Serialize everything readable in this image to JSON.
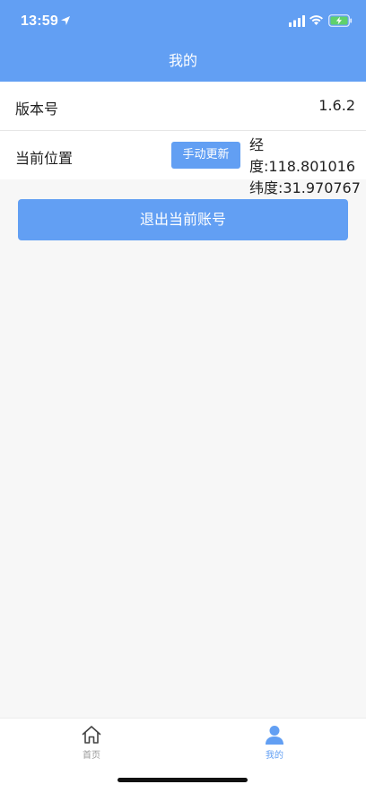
{
  "status": {
    "time": "13:59"
  },
  "header": {
    "title": "我的"
  },
  "settings": {
    "version_label": "版本号",
    "version_value": "1.6.2",
    "location_label": "当前位置",
    "update_button": "手动更新",
    "longitude": "经度:118.801016",
    "latitude": "纬度:31.970767"
  },
  "actions": {
    "logout": "退出当前账号"
  },
  "tabbar": {
    "home": "首页",
    "mine": "我的"
  },
  "colors": {
    "accent": "#629ff3",
    "background": "#f7f7f7"
  },
  "icons": {
    "home": "home-icon",
    "mine": "user-icon"
  }
}
